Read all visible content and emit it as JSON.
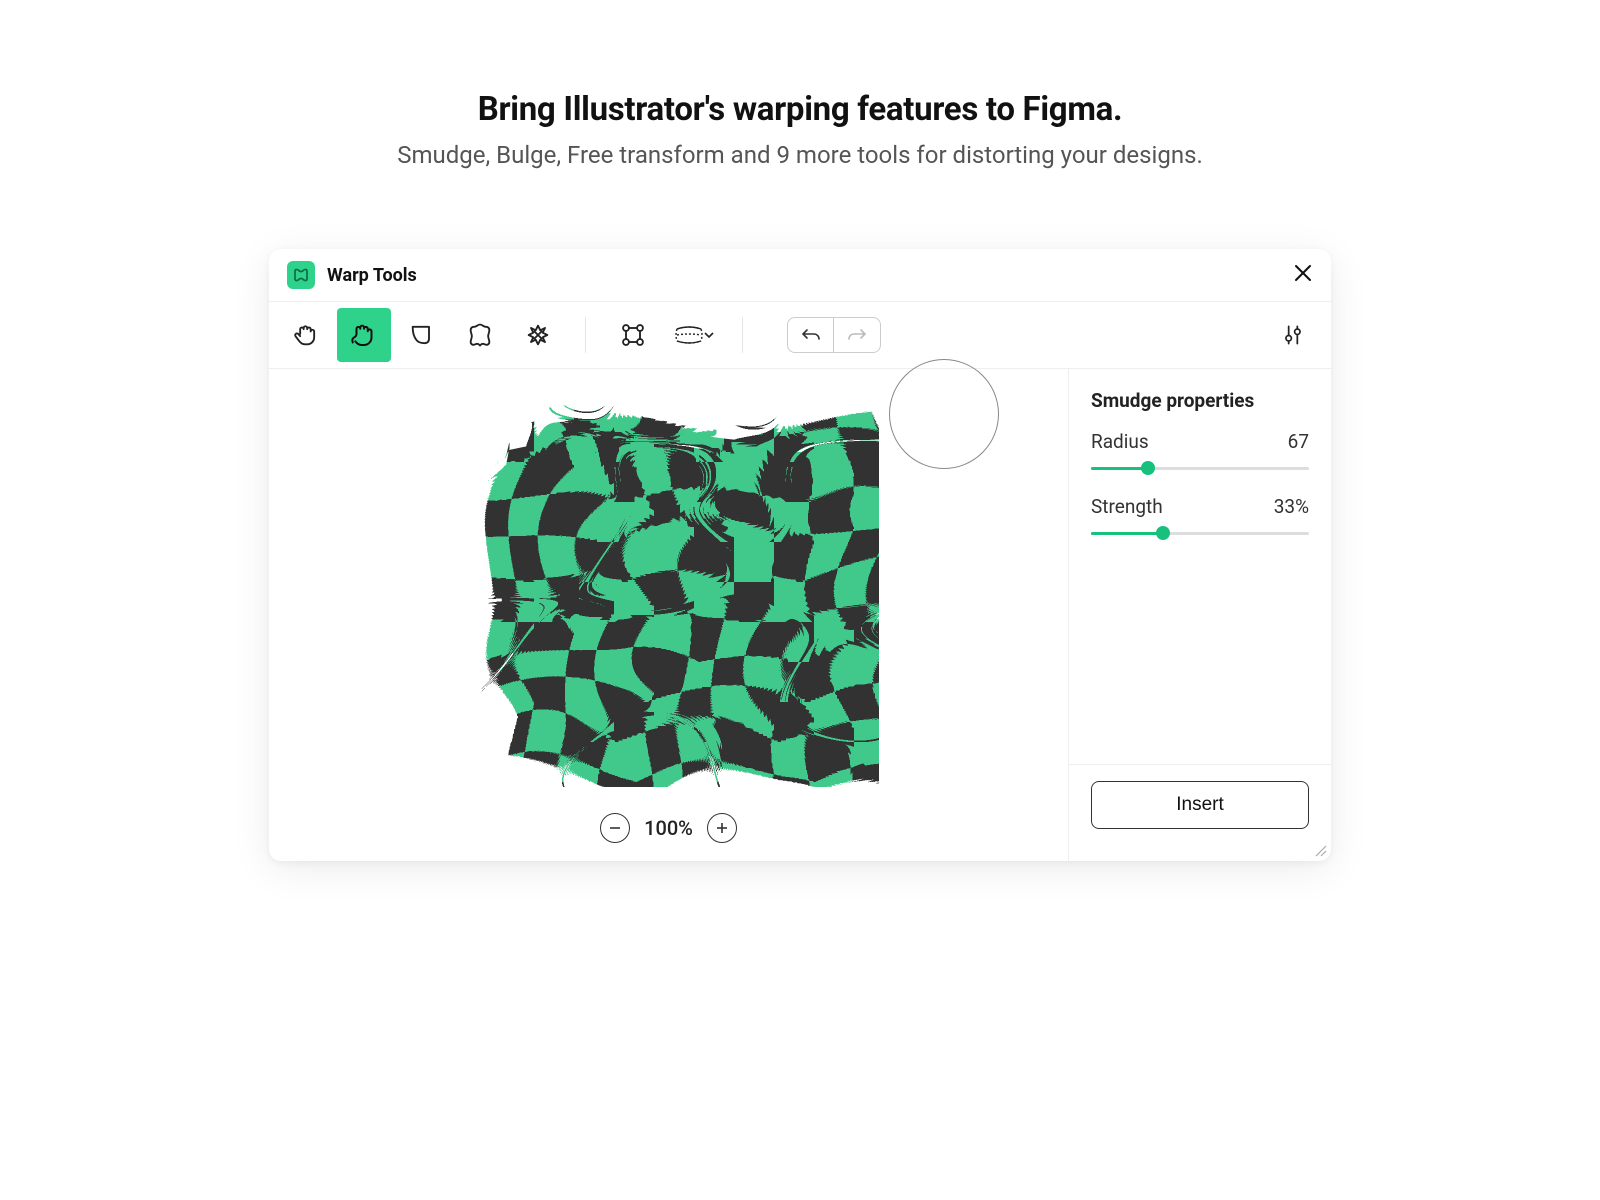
{
  "hero": {
    "headline": "Bring Illustrator's warping features to Figma.",
    "subhead": "Smudge, Bulge, Free transform and 9 more tools for distorting your designs."
  },
  "window": {
    "title": "Warp Tools"
  },
  "toolbar": {
    "tools": [
      "hand",
      "smudge",
      "bulge",
      "shape",
      "composite",
      "free-transform",
      "mesh"
    ],
    "active_index": 1
  },
  "canvas": {
    "zoom_label": "100%"
  },
  "panel": {
    "title": "Smudge properties",
    "radius_label": "Radius",
    "radius_value": "67",
    "radius_pct": 26,
    "strength_label": "Strength",
    "strength_value": "33%",
    "strength_pct": 33,
    "insert_label": "Insert"
  },
  "colors": {
    "accent": "#2fd28a",
    "dark": "#303030"
  }
}
